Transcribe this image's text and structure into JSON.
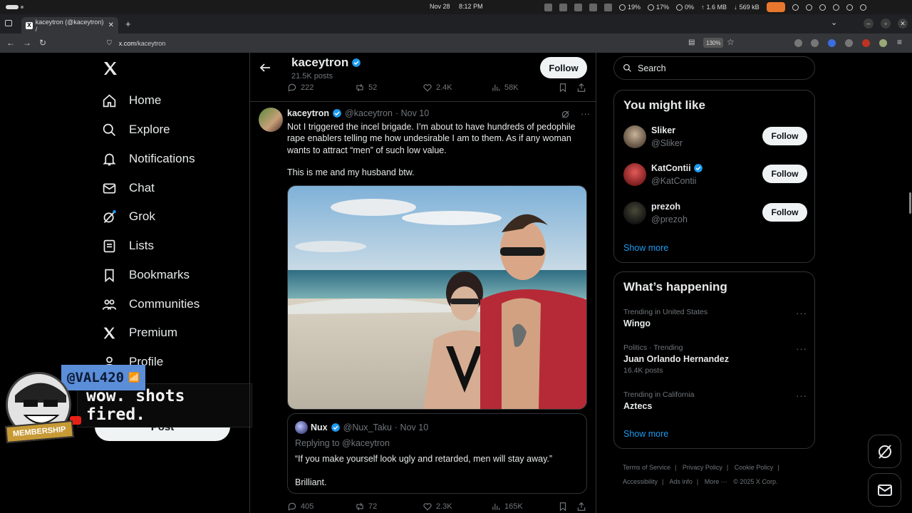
{
  "os": {
    "date": "Nov 28",
    "time": "8:12 PM",
    "cpu": "19%",
    "mem": "17%",
    "swap": "0%",
    "net_up": "1.6 MB",
    "net_down": "569 kB"
  },
  "browser": {
    "tab_title": "kaceytron (@kaceytron) / ",
    "url_domain": "x.com",
    "url_path": "/kaceytron",
    "zoom": "130%"
  },
  "nav": {
    "items": [
      {
        "label": "Home",
        "icon": "home-icon"
      },
      {
        "label": "Explore",
        "icon": "search-icon"
      },
      {
        "label": "Notifications",
        "icon": "bell-icon"
      },
      {
        "label": "Chat",
        "icon": "mail-icon"
      },
      {
        "label": "Grok",
        "icon": "grok-icon"
      },
      {
        "label": "Lists",
        "icon": "list-icon"
      },
      {
        "label": "Bookmarks",
        "icon": "bookmark-icon"
      },
      {
        "label": "Communities",
        "icon": "people-icon"
      },
      {
        "label": "Premium",
        "icon": "x-logo-icon"
      },
      {
        "label": "Profile",
        "icon": "user-icon"
      }
    ],
    "post_label": "Post"
  },
  "overlay": {
    "username": "@VAL420",
    "message": "wow. shots fired.",
    "badge": "MEMBERSHIP"
  },
  "profile_header": {
    "name": "kaceytron",
    "posts": "21.5K posts",
    "follow_label": "Follow"
  },
  "prev_actions": {
    "replies": "222",
    "reposts": "52",
    "likes": "2.4K",
    "views": "58K"
  },
  "tweet": {
    "name": "kaceytron",
    "handle": "@kaceytron",
    "date": "· Nov 10",
    "text": "Not I triggered the incel brigade. I’m about to have hundreds of pedophile rape enablers telling me how undesirable I am to them. As if any woman wants to attract “men” of such low value.",
    "text2": "This is me and my husband btw.",
    "quote": {
      "name": "Nux",
      "handle": "@Nux_Taku",
      "date": "· Nov 10",
      "replying": "Replying to @kaceytron",
      "text": "“If you make yourself look ugly and retarded, men will stay away.”",
      "text2": "Brilliant."
    },
    "actions": {
      "replies": "405",
      "reposts": "72",
      "likes": "2.3K",
      "views": "165K"
    }
  },
  "right": {
    "search_placeholder": "Search",
    "you_might_like": {
      "title": "You might like",
      "users": [
        {
          "name": "Sliker",
          "handle": "@Sliker",
          "verified": false,
          "follow": "Follow"
        },
        {
          "name": "KatContii",
          "handle": "@KatContii",
          "verified": true,
          "follow": "Follow"
        },
        {
          "name": "prezoh",
          "handle": "@prezoh",
          "verified": false,
          "follow": "Follow"
        }
      ],
      "show_more": "Show more"
    },
    "whats_happening": {
      "title": "What’s happening",
      "trends": [
        {
          "context": "Trending in United States",
          "title": "Wingo",
          "posts": ""
        },
        {
          "context": "Politics · Trending",
          "title": "Juan Orlando Hernandez",
          "posts": "16.4K posts"
        },
        {
          "context": "Trending in California",
          "title": "Aztecs",
          "posts": ""
        }
      ],
      "show_more": "Show more"
    },
    "footer": {
      "tos": "Terms of Service",
      "privacy": "Privacy Policy",
      "cookie": "Cookie Policy",
      "accessibility": "Accessibility",
      "ads": "Ads info",
      "more": "More ···",
      "copyright": "© 2025 X Corp."
    }
  },
  "colors": {
    "accent": "#1d9bf0",
    "background": "#000000",
    "border": "#2f3336",
    "muted": "#71767b"
  }
}
